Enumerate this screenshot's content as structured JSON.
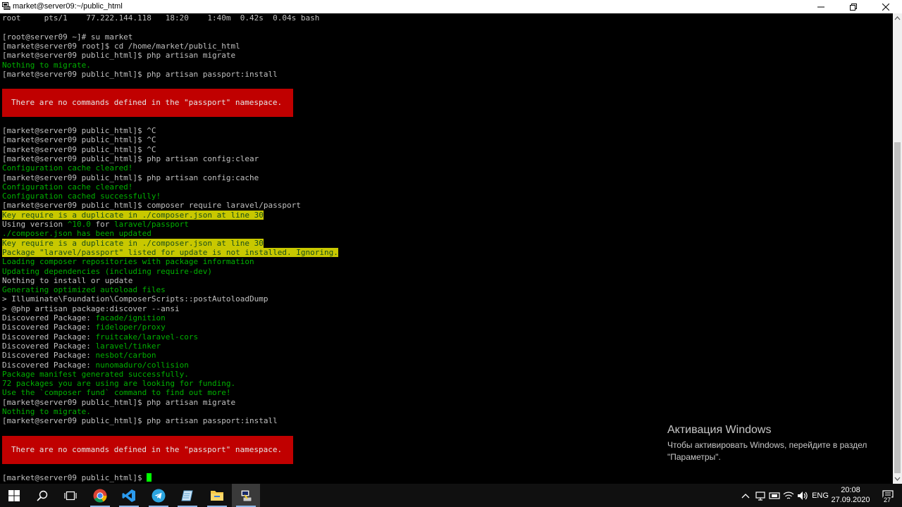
{
  "window": {
    "title": "market@server09:~/public_html"
  },
  "terminal": {
    "lines": [
      "root     pts/1    77.222.144.118   18:20    1:40m  0.42s  0.04s bash",
      "",
      "[root@server09 ~]# su market",
      "[market@server09 root]$ cd /home/market/public_html",
      "[market@server09 public_html]$ php artisan migrate",
      "Nothing to migrate.",
      "[market@server09 public_html]$ php artisan passport:install",
      "There are no commands defined in the \"passport\" namespace.",
      "[market@server09 public_html]$ ^C",
      "[market@server09 public_html]$ ^C",
      "[market@server09 public_html]$ ^C",
      "[market@server09 public_html]$ php artisan config:clear",
      "Configuration cache cleared!",
      "[market@server09 public_html]$ php artisan config:cache",
      "Configuration cache cleared!",
      "Configuration cached successfully!",
      "[market@server09 public_html]$ composer require laravel/passport",
      "Key require is a duplicate in ./composer.json at line 30",
      "Using version ",
      "^10.0",
      " for ",
      "laravel/passport",
      "./composer.json has been updated",
      "Key require is a duplicate in ./composer.json at line 30",
      "Package \"laravel/passport\" listed for update is not installed. Ignoring.",
      "Loading composer repositories with package information",
      "Updating dependencies (including require-dev)",
      "Nothing to install or update",
      "Generating optimized autoload files",
      "> Illuminate\\Foundation\\ComposerScripts::postAutoloadDump",
      "> @php artisan package:discover --ansi",
      "Discovered Package: ",
      "facade/ignition",
      "fideloper/proxy",
      "fruitcake/laravel-cors",
      "laravel/tinker",
      "nesbot/carbon",
      "nunomaduro/collision",
      "Package manifest generated successfully.",
      "72 packages you are using are looking for funding.",
      "Use the `composer fund` command to find out more!",
      "[market@server09 public_html]$ php artisan migrate",
      "Nothing to migrate.",
      "[market@server09 public_html]$ php artisan passport:install",
      "[market@server09 public_html]$ "
    ]
  },
  "activation": {
    "title": "Активация Windows",
    "subtitle": "Чтобы активировать Windows, перейдите в раздел \"Параметры\"."
  },
  "taskbar": {
    "language": "ENG",
    "time": "20:08",
    "date": "27.09.2020",
    "notifications": "27"
  },
  "colors": {
    "terminal_bg": "#000000",
    "terminal_fg": "#c0c0c0",
    "success_green": "#00b000",
    "warning_bg": "#c8c800",
    "error_bg": "#c00000",
    "cursor": "#00ff00"
  },
  "icons": [
    "putty-icon",
    "minimize-icon",
    "restore-icon",
    "close-icon",
    "windows-start-icon",
    "search-icon",
    "task-view-icon",
    "chrome-icon",
    "vscode-icon",
    "telegram-icon",
    "notepad-icon",
    "file-explorer-icon",
    "putty-icon",
    "chevron-up-icon",
    "network-icon",
    "onedrive-icon",
    "wifi-icon",
    "volume-icon",
    "notification-icon"
  ]
}
